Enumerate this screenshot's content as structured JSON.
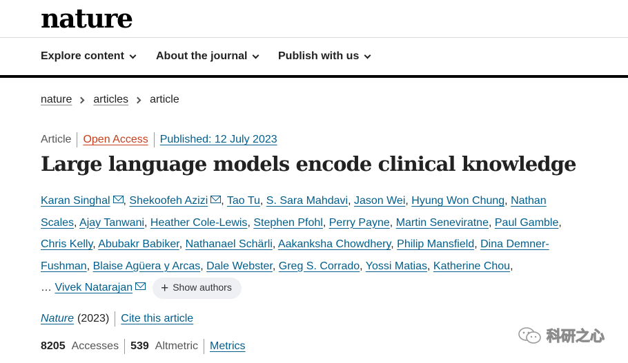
{
  "header": {
    "logo": "nature"
  },
  "nav": {
    "items": [
      {
        "label": "Explore content"
      },
      {
        "label": "About the journal"
      },
      {
        "label": "Publish with us"
      }
    ]
  },
  "breadcrumb": {
    "items": [
      "nature",
      "articles",
      "article"
    ]
  },
  "article": {
    "type": "Article",
    "access": "Open Access",
    "published": "Published: 12 July 2023",
    "title": "Large language models encode clinical knowledge",
    "authors": [
      "Karan Singhal",
      "Shekoofeh Azizi",
      "Tao Tu",
      "S. Sara Mahdavi",
      "Jason Wei",
      "Hyung Won Chung",
      "Nathan Scales",
      "Ajay Tanwani",
      "Heather Cole-Lewis",
      "Stephen Pfohl",
      "Perry Payne",
      "Martin Seneviratne",
      "Paul Gamble",
      "Chris Kelly",
      "Abubakr Babiker",
      "Nathanael Schärli",
      "Aakanksha Chowdhery",
      "Philip Mansfield",
      "Dina Demner-Fushman",
      "Blaise Agüera y Arcas",
      "Dale Webster",
      "Greg S. Corrado",
      "Yossi Matias",
      "Katherine Chou",
      "Vivek Natarajan"
    ],
    "ellipsis": "…",
    "show_authors": "Show authors",
    "journal": "Nature",
    "year": "(2023)",
    "cite": "Cite this article"
  },
  "metrics": {
    "accesses_value": "8205",
    "accesses_label": "Accesses",
    "altmetric_value": "539",
    "altmetric_label": "Altmetric",
    "metrics_link": "Metrics"
  },
  "watermark": {
    "text": "科研之心"
  }
}
